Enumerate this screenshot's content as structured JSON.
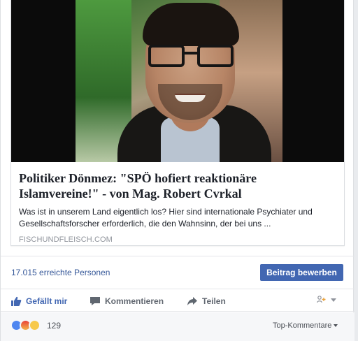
{
  "link_card": {
    "title": "Politiker Dönmez: \"SPÖ hofiert reaktionäre Islamvereine!\" - von Mag. Robert Cvrkal",
    "description": "Was ist in unserem Land eigentlich los? Hier sind internationale Psychiater und Gesellschaftsforscher erforderlich, die den Wahnsinn, der bei uns ...",
    "domain": "FISCHUNDFLEISCH.COM"
  },
  "reach": {
    "text": "17.015 erreichte Personen",
    "boost_label": "Beitrag bewerben"
  },
  "actions": {
    "like": "Gefällt mir",
    "comment": "Kommentieren",
    "share": "Teilen"
  },
  "reactions": {
    "count": "129",
    "sort_label": "Top-Kommentare"
  },
  "colors": {
    "link_blue": "#365899",
    "brand_blue": "#4267b2",
    "muted": "#90949c"
  }
}
